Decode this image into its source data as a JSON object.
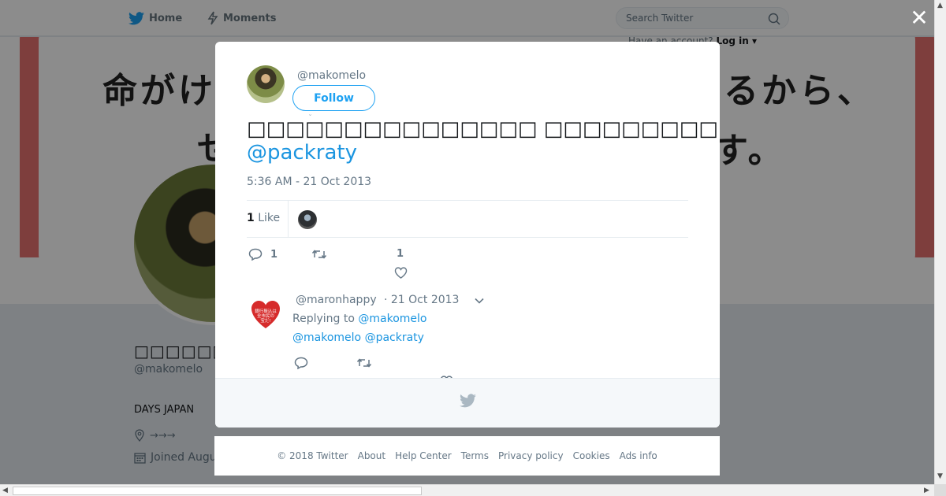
{
  "nav": {
    "home_label": "Home",
    "moments_label": "Moments",
    "search_placeholder": "Search Twitter",
    "have_account": "Have an account?",
    "login_label": "Log in"
  },
  "banner": {
    "line1_left": "命がけ",
    "line1_right": "いるから、",
    "line2_left": "せ",
    "line2_right": "す。"
  },
  "profile": {
    "name": "□□□□□□",
    "handle": "@makomelo",
    "bio": "DAYS JAPAN",
    "location": "→→→",
    "joined": "Joined Augu"
  },
  "modal": {
    "close_glyph": "✕",
    "author_handle": "@makomelo",
    "follow_label": "Follow",
    "caret": "ˇ",
    "tweet_text": "□□□□□□□□□□□□□□□ □□□□□□□□□□□□□□□□□□□□□□□□□□□□□□□□□□□□□□□□□□□□□",
    "tweet_mention": "@packraty",
    "timestamp": "5:36 AM - 21 Oct 2013",
    "like_count": "1",
    "like_label": "Like",
    "actions": {
      "reply_count": "1",
      "retweet_count": "",
      "like_count": "1"
    },
    "reply": {
      "handle": "@maronhappy",
      "date": "· 21 Oct 2013",
      "replying_prefix": "Replying to",
      "replying_handle": "@makomelo",
      "body_mention1": "@makomelo",
      "body_mention2": "@packraty",
      "avatar_text": "銀行振込は全市民の宝だ!"
    }
  },
  "footer": {
    "links": [
      "© 2018 Twitter",
      "About",
      "Help Center",
      "Terms",
      "Privacy policy",
      "Cookies",
      "Ads info"
    ]
  },
  "colors": {
    "brand": "#1da1f2",
    "link": "#1b95e0",
    "banner_frame": "#e5726f"
  }
}
